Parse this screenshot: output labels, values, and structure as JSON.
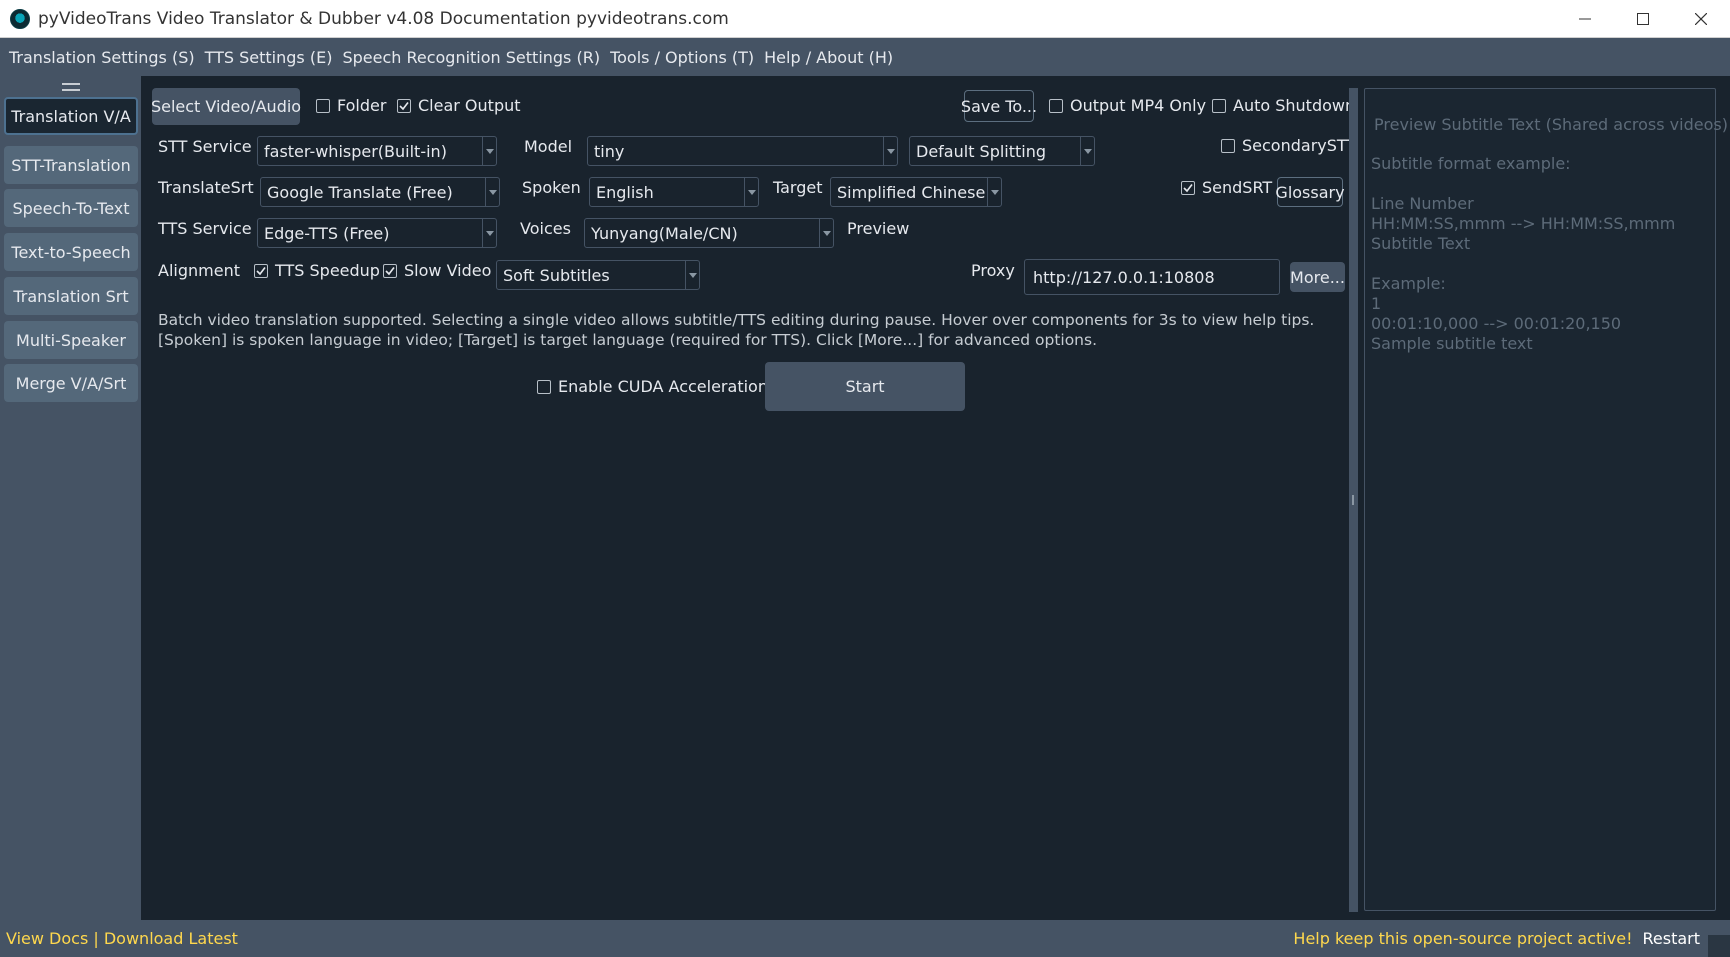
{
  "window": {
    "title": "pyVideoTrans Video Translator & Dubber v4.08 Documentation pyvideotrans.com"
  },
  "menu": [
    "Translation Settings (S)",
    "TTS Settings (E)",
    "Speech Recognition Settings (R)",
    "Tools / Options (T)",
    "Help / About (H)"
  ],
  "nav": [
    {
      "label": "Translation V/A",
      "active": true
    },
    {
      "label": "STT-Translation",
      "active": false
    },
    {
      "label": "Speech-To-Text",
      "active": false
    },
    {
      "label": "Text-to-Speech",
      "active": false
    },
    {
      "label": "Translation Srt",
      "active": false
    },
    {
      "label": "Multi-Speaker",
      "active": false
    },
    {
      "label": "Merge V/A/Srt",
      "active": false
    }
  ],
  "row1": {
    "select_button": "Select Video/Audio",
    "folder": {
      "label": "Folder",
      "checked": false
    },
    "clear_output": {
      "label": "Clear Output",
      "checked": true
    },
    "save_button": "Save To...",
    "output_mp4": {
      "label": "Output MP4 Only",
      "checked": false
    },
    "auto_shutdown": {
      "label": "Auto Shutdown",
      "checked": false
    }
  },
  "row2": {
    "stt_label": "STT Service",
    "stt_value": "faster-whisper(Built-in)",
    "model_label": "Model",
    "model_value": "tiny",
    "split_value": "Default Splitting",
    "secondary_stt": {
      "label": "SecondarySTT",
      "checked": false
    }
  },
  "row3": {
    "translate_label": "TranslateSrt",
    "translate_value": "Google Translate (Free)",
    "spoken_label": "Spoken",
    "spoken_value": "English",
    "target_label": "Target",
    "target_value": "Simplified Chinese",
    "send_srt": {
      "label": "SendSRT",
      "checked": true
    },
    "glossary_button": "Glossary"
  },
  "row4": {
    "tts_label": "TTS Service",
    "tts_value": "Edge-TTS (Free)",
    "voices_label": "Voices",
    "voices_value": "Yunyang(Male/CN)",
    "preview_label": "Preview"
  },
  "row5": {
    "alignment_label": "Alignment",
    "tts_speedup": {
      "label": "TTS Speedup",
      "checked": true
    },
    "slow_video": {
      "label": "Slow Video",
      "checked": true
    },
    "subtitle_value": "Soft Subtitles",
    "proxy_label": "Proxy",
    "proxy_value": "http://127.0.0.1:10808",
    "more_button": "More..."
  },
  "help": {
    "line1": "Batch video translation supported. Selecting a single video allows subtitle/TTS editing during pause. Hover over components for 3s to view help tips.",
    "line2": "[Spoken] is spoken language in video; [Target] is target language (required for TTS). Click [More...] for advanced options."
  },
  "actions": {
    "cuda": {
      "label": "Enable CUDA Acceleration?",
      "checked": false
    },
    "start_button": "Start"
  },
  "preview": {
    "placeholder": "Preview Subtitle Text (Shared across videos)",
    "lines": [
      "Subtitle format example:",
      "",
      "Line Number",
      "HH:MM:SS,mmm --> HH:MM:SS,mmm",
      "Subtitle Text",
      "",
      "Example:",
      "1",
      "00:01:10,000 --> 00:01:20,150",
      "Sample subtitle text"
    ]
  },
  "status": {
    "left": "View Docs | Download Latest",
    "right": "Help keep this open-source project active!",
    "restart": "Restart"
  },
  "colors": {
    "background": "#19232d",
    "panel": "#455364",
    "accent_text": "#ffd84d"
  },
  "icons": {
    "app": "app-logo-icon",
    "minimize": "minimize-icon",
    "maximize": "maximize-icon",
    "close": "close-icon",
    "check": "check-icon",
    "dropdown": "chevron-down-icon"
  }
}
